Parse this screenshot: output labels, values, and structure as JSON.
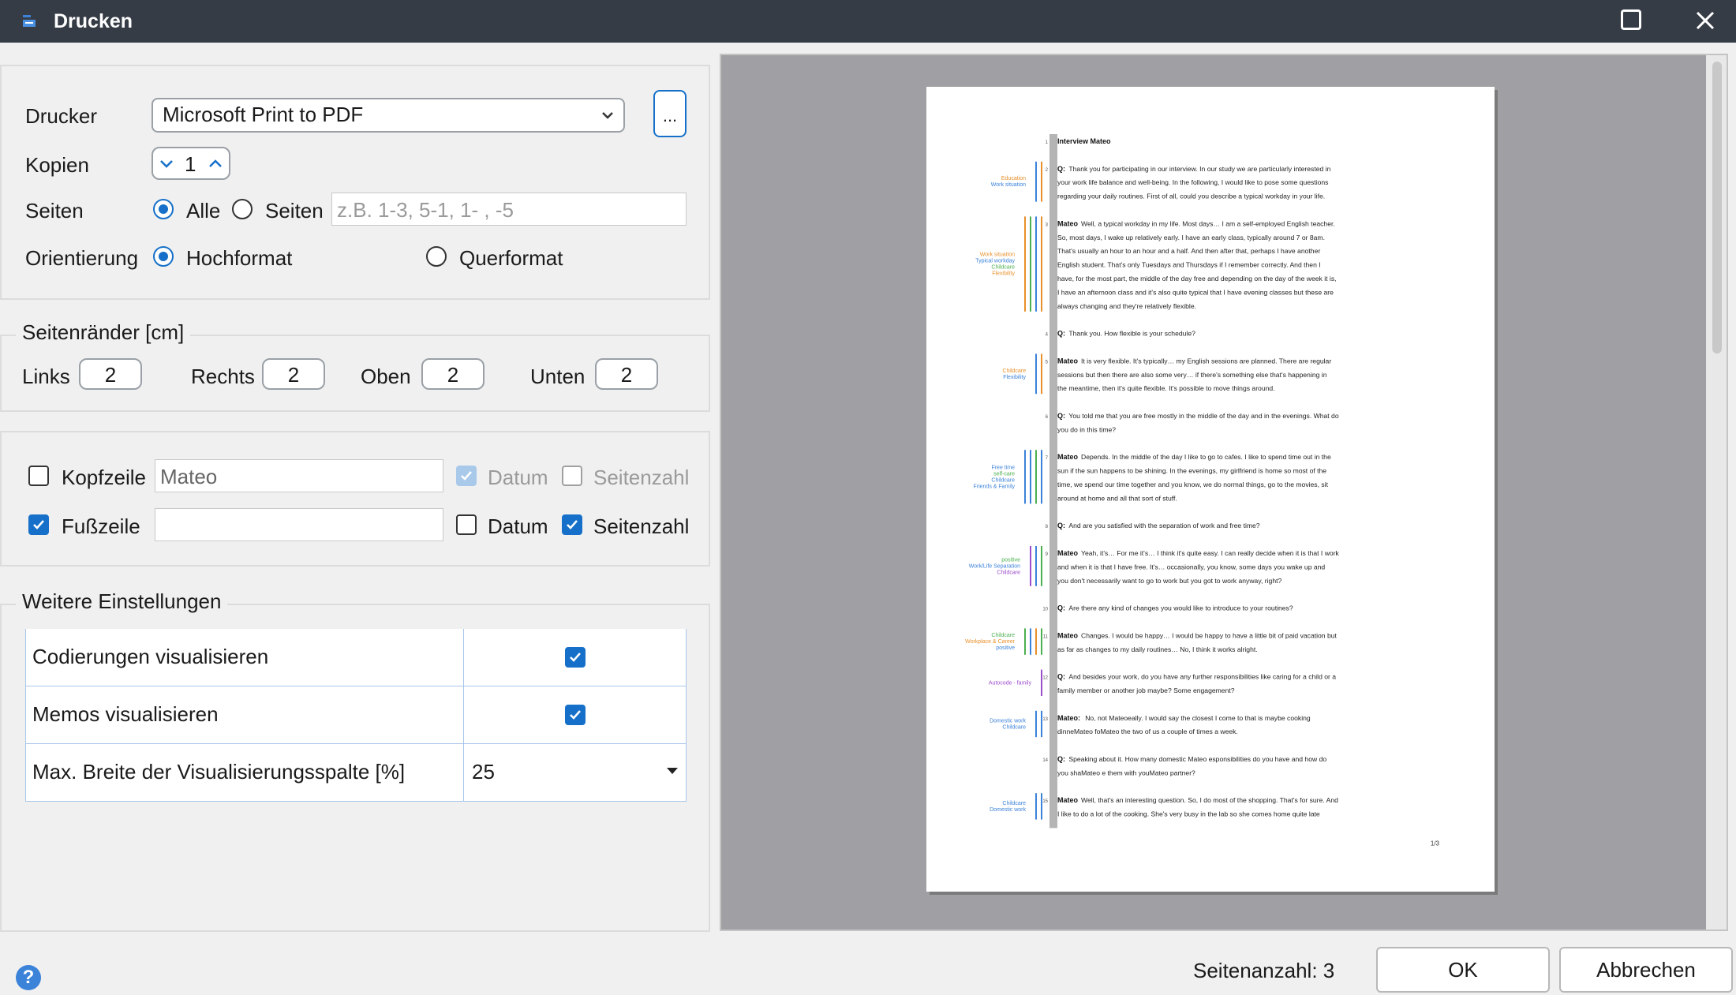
{
  "window": {
    "title": "Drucken"
  },
  "printer": {
    "label": "Drucker",
    "selected": "Microsoft Print to PDF",
    "more_label": "...",
    "copies_label": "Kopien",
    "copies_value": "1",
    "pages_label": "Seiten",
    "pages_all_label": "Alle",
    "pages_range_label": "Seiten",
    "pages_range_placeholder": "z.B. 1-3, 5-1, 1- , -5",
    "orientation_label": "Orientierung",
    "portrait_label": "Hochformat",
    "landscape_label": "Querformat"
  },
  "margins": {
    "title": "Seitenränder [cm]",
    "left_label": "Links",
    "left_value": "2",
    "right_label": "Rechts",
    "right_value": "2",
    "top_label": "Oben",
    "top_value": "2",
    "bottom_label": "Unten",
    "bottom_value": "2"
  },
  "header_footer": {
    "header_label": "Kopfzeile",
    "header_checked": false,
    "header_text": "Mateo",
    "header_date_label": "Datum",
    "header_date_checked": true,
    "header_page_label": "Seitenzahl",
    "header_page_checked": false,
    "footer_label": "Fußzeile",
    "footer_checked": true,
    "footer_text": "",
    "footer_date_label": "Datum",
    "footer_date_checked": false,
    "footer_page_label": "Seitenzahl",
    "footer_page_checked": true
  },
  "settings": {
    "title": "Weitere Einstellungen",
    "rows": [
      {
        "label": "Codierungen visualisieren",
        "checked": true
      },
      {
        "label": "Memos visualisieren",
        "checked": true
      },
      {
        "label": "Max. Breite der Visualisierungsspalte [%]",
        "value": "25"
      }
    ]
  },
  "preview": {
    "doc_title": "Interview Mateo",
    "page_number": "1/3",
    "paragraphs": [
      {
        "n": "1",
        "speaker": "Interview Mateo",
        "lines": []
      },
      {
        "n": "2",
        "speaker": "Q:",
        "lines": [
          "Thank you for participating in our interview. In our study we are particularly interested in",
          "your work life balance and well-being. In the following, I would like to pose some questions",
          "regarding your daily routines. First of all, could you describe a typical workday in your life."
        ]
      },
      {
        "n": "3",
        "speaker": "Mateo",
        "lines": [
          "Well, a typical workday in my life. Most days… I am a self-employed English teacher.",
          "So, most days, I wake up relatively early. I have an early class, typically around 7 or 8am.",
          "That's usually an hour to an hour and a half. And then after that, perhaps I have another",
          "English student. That's only Tuesdays and Thursdays if I remember correctly. And then I",
          "have, for the most part, the middle of the day free and depending on the day of the week it is,",
          "I have an afternoon class and it's also quite typical that I have evening classes but these are",
          "always changing and they're relatively flexible."
        ]
      },
      {
        "n": "4",
        "speaker": "Q:",
        "lines": [
          "Thank you. How flexible is your schedule?"
        ]
      },
      {
        "n": "5",
        "speaker": "Mateo",
        "lines": [
          "It is very flexible. It's typically… my English sessions are planned. There are regular",
          "sessions but then there are also some very… if there's something else that's happening in",
          "the meantime, then it's quite flexible. It's possible to move things around."
        ]
      },
      {
        "n": "6",
        "speaker": "Q:",
        "lines": [
          "You told me that you are free mostly in the middle of the day and in the evenings. What do",
          "you do in this time?"
        ]
      },
      {
        "n": "7",
        "speaker": "Mateo",
        "lines": [
          "Depends. In the middle of the day I like to go to cafes. I like to spend time out in the",
          "sun if the sun happens to be shining. In the evenings, my girlfriend is home so most of the",
          "time, we spend our time together and you know, we do normal things, go to the movies, sit",
          "around at home and all that sort of stuff."
        ]
      },
      {
        "n": "8",
        "speaker": "Q:",
        "lines": [
          "And are you satisfied with the separation of work and free time?"
        ]
      },
      {
        "n": "9",
        "speaker": "Mateo",
        "lines": [
          "Yeah, it's… For me it's… I think it's quite easy. I can really decide when it is that I work",
          "and when it is that I have free. It's… occasionally, you know, some days you wake up and",
          "you don't necessarily want to go to work but you got to work anyway, right?"
        ]
      },
      {
        "n": "10",
        "speaker": "Q:",
        "lines": [
          "Are there any kind of changes you would like to introduce to your routines?"
        ]
      },
      {
        "n": "11",
        "speaker": "Mateo",
        "lines": [
          "Changes. I would be happy… I would be happy to have a little bit of paid vacation but",
          "as far as changes to my daily routines… No, I think it works alright."
        ]
      },
      {
        "n": "12",
        "speaker": "Q:",
        "lines": [
          "And besides your work, do you have any further responsibilities like caring for a child or a",
          "family member or another job maybe? Some engagement?"
        ]
      },
      {
        "n": "13",
        "speaker": "Mateo:",
        "lines": [
          "No, not Mateoeally. I would say the closest I come to that is maybe cooking",
          "dinneMateo foMateo the two of us a couple of times a week."
        ]
      },
      {
        "n": "14",
        "speaker": "Q:",
        "lines": [
          "Speaking about it. How many domestic Mateo esponsibilities do you have and how do",
          "you shaMateo e them with youMateo  partner?"
        ]
      },
      {
        "n": "15",
        "speaker": "Mateo",
        "lines": [
          "Well, that's an interesting question. So, I do most of the shopping. That's for sure. And",
          "I like to do a lot of the cooking. She's very busy in the lab so she comes home quite late"
        ]
      }
    ],
    "codes": [
      {
        "para": "2",
        "labels": [
          "Education",
          "Work situation"
        ],
        "colors": [
          "#e8902a",
          "#3b82d9"
        ]
      },
      {
        "para": "3",
        "labels": [
          "Work situation",
          "Typical workday",
          "Childcare",
          "Flexibility"
        ],
        "colors": [
          "#e8902a",
          "#3b82d9",
          "#4caf50",
          "#e8902a"
        ]
      },
      {
        "para": "5",
        "labels": [
          "Childcare",
          "Flexibility"
        ],
        "colors": [
          "#e8902a",
          "#3b82d9"
        ]
      },
      {
        "para": "7",
        "labels": [
          "Free time",
          "self-care",
          "Childcare",
          "Friends & Family"
        ],
        "colors": [
          "#3b82d9",
          "#4caf50",
          "#3b82d9",
          "#3b82d9"
        ]
      },
      {
        "para": "9",
        "labels": [
          "positive",
          "Work/Life Separation",
          "Childcare"
        ],
        "colors": [
          "#4caf50",
          "#3b82d9",
          "#9c4dcc"
        ]
      },
      {
        "para": "11",
        "labels": [
          "Childcare",
          "Workplace & Career",
          "positive"
        ],
        "colors": [
          "#4caf50",
          "#e8902a",
          "#3b82d9",
          "#4caf50"
        ]
      },
      {
        "para": "12",
        "labels": [
          "Autocode - family"
        ],
        "colors": [
          "#9c4dcc"
        ]
      },
      {
        "para": "13",
        "labels": [
          "Domestic work",
          "Childcare"
        ],
        "colors": [
          "#3b82d9",
          "#3b82d9"
        ]
      },
      {
        "para": "15",
        "labels": [
          "Childcare",
          "Domestic work"
        ],
        "colors": [
          "#3b82d9",
          "#3b82d9"
        ]
      }
    ]
  },
  "footer": {
    "page_count": "Seitenanzahl: 3",
    "ok_label": "OK",
    "cancel_label": "Abbrechen",
    "help_label": "?"
  },
  "colors": {
    "accent": "#1670c9",
    "titlebar": "#363c46",
    "preview_bg": "#a0a0a4"
  }
}
